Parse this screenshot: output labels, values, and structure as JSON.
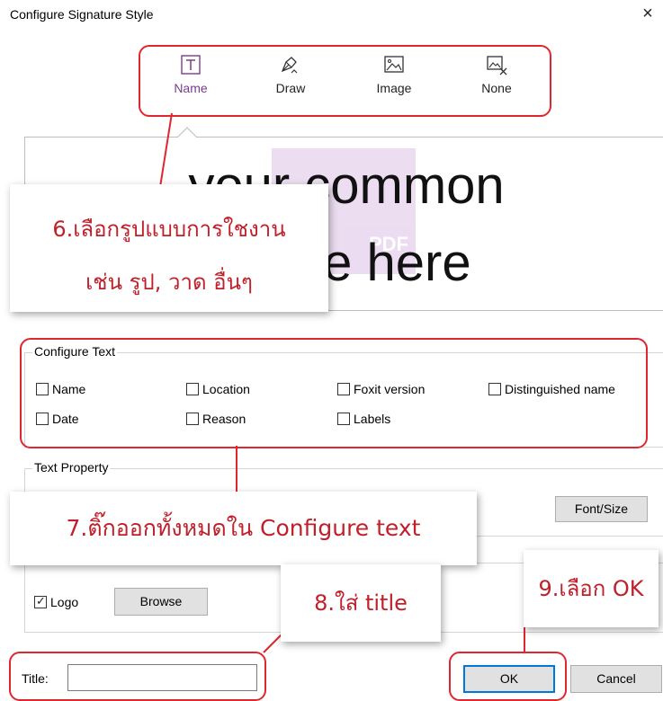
{
  "dialog": {
    "title": "Configure Signature Style",
    "close_glyph": "×"
  },
  "style_tabs": [
    {
      "label": "Name",
      "icon": "text-t-icon",
      "active": true
    },
    {
      "label": "Draw",
      "icon": "pen-draw-icon",
      "active": false
    },
    {
      "label": "Image",
      "icon": "image-icon",
      "active": false
    },
    {
      "label": "None",
      "icon": "image-none-icon",
      "active": false
    }
  ],
  "preview": {
    "line1": "your common",
    "line2": "name here",
    "watermark_text": "PDF"
  },
  "callouts": {
    "step6_line1": "6.เลือกรูปแบบการใชงาน",
    "step6_line2": "เช่น รูป, วาด อื่นๆ",
    "step7": "7.ติ๊กออกทั้งหมดใน Configure text",
    "step8": "8.ใส่ title",
    "step9": "9.เลือก OK"
  },
  "configure_text": {
    "label": "Configure Text",
    "options": [
      {
        "label": "Name",
        "checked": false
      },
      {
        "label": "Location",
        "checked": false
      },
      {
        "label": "Foxit version",
        "checked": false
      },
      {
        "label": "Distinguished name",
        "checked": false
      },
      {
        "label": "Date",
        "checked": false
      },
      {
        "label": "Reason",
        "checked": false
      },
      {
        "label": "Labels",
        "checked": false
      }
    ]
  },
  "text_property": {
    "label": "Text Property",
    "font_size_button": "Font/Size"
  },
  "logo_group": {
    "logo_label": "Logo",
    "logo_checked": true,
    "browse_button": "Browse"
  },
  "footer": {
    "title_label": "Title:",
    "title_value": "",
    "ok_button": "OK",
    "cancel_button": "Cancel"
  },
  "colors": {
    "annotation_red": "#e0262e",
    "active_tab_purple": "#7a3d8a",
    "callout_text": "#c0202a"
  }
}
